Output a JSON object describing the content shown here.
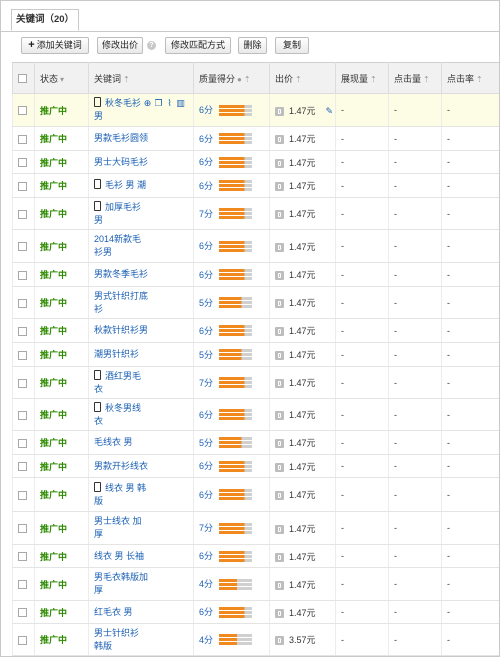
{
  "tab": {
    "label": "关键词（20）"
  },
  "toolbar": {
    "add": "添加关键词",
    "modify_price": "修改出价",
    "modify_match": "修改匹配方式",
    "delete": "删除",
    "copy": "复制"
  },
  "columns": {
    "status": "状态",
    "keyword": "关键词",
    "quality": "质量得分",
    "price": "出价",
    "impressions": "展现量",
    "clicks": "点击量",
    "ctr": "点击率"
  },
  "rows": [
    {
      "status": "推广中",
      "l1": "秋冬毛衫",
      "l2": "男",
      "mobile": true,
      "score": "6分",
      "price": "1.47元",
      "imp": "-",
      "clk": "-",
      "ctr": "-"
    },
    {
      "status": "推广中",
      "l1": "男款毛衫圆领",
      "l2": "",
      "mobile": false,
      "score": "6分",
      "price": "1.47元",
      "imp": "-",
      "clk": "-",
      "ctr": "-"
    },
    {
      "status": "推广中",
      "l1": "男士大码毛衫",
      "l2": "",
      "mobile": false,
      "score": "6分",
      "price": "1.47元",
      "imp": "-",
      "clk": "-",
      "ctr": "-"
    },
    {
      "status": "推广中",
      "l1": "毛衫 男 潮",
      "l2": "",
      "mobile": true,
      "score": "6分",
      "price": "1.47元",
      "imp": "-",
      "clk": "-",
      "ctr": "-"
    },
    {
      "status": "推广中",
      "l1": "加厚毛衫",
      "l2": "男",
      "mobile": true,
      "score": "7分",
      "price": "1.47元",
      "imp": "-",
      "clk": "-",
      "ctr": "-"
    },
    {
      "status": "推广中",
      "l1": "2014新款毛",
      "l2": "衫男",
      "mobile": false,
      "score": "6分",
      "price": "1.47元",
      "imp": "-",
      "clk": "-",
      "ctr": "-"
    },
    {
      "status": "推广中",
      "l1": "男款冬季毛衫",
      "l2": "",
      "mobile": false,
      "score": "6分",
      "price": "1.47元",
      "imp": "-",
      "clk": "-",
      "ctr": "-"
    },
    {
      "status": "推广中",
      "l1": "男式针织打底",
      "l2": "衫",
      "mobile": false,
      "score": "5分",
      "price": "1.47元",
      "imp": "-",
      "clk": "-",
      "ctr": "-"
    },
    {
      "status": "推广中",
      "l1": "秋款针织衫男",
      "l2": "",
      "mobile": false,
      "score": "6分",
      "price": "1.47元",
      "imp": "-",
      "clk": "-",
      "ctr": "-"
    },
    {
      "status": "推广中",
      "l1": "潮男针织衫",
      "l2": "",
      "mobile": false,
      "score": "5分",
      "price": "1.47元",
      "imp": "-",
      "clk": "-",
      "ctr": "-"
    },
    {
      "status": "推广中",
      "l1": "酒红男毛",
      "l2": "衣",
      "mobile": true,
      "score": "7分",
      "price": "1.47元",
      "imp": "-",
      "clk": "-",
      "ctr": "-"
    },
    {
      "status": "推广中",
      "l1": "秋冬男线",
      "l2": "衣",
      "mobile": true,
      "score": "6分",
      "price": "1.47元",
      "imp": "-",
      "clk": "-",
      "ctr": "-"
    },
    {
      "status": "推广中",
      "l1": "毛线衣 男",
      "l2": "",
      "mobile": false,
      "score": "5分",
      "price": "1.47元",
      "imp": "-",
      "clk": "-",
      "ctr": "-"
    },
    {
      "status": "推广中",
      "l1": "男款开衫线衣",
      "l2": "",
      "mobile": false,
      "score": "6分",
      "price": "1.47元",
      "imp": "-",
      "clk": "-",
      "ctr": "-"
    },
    {
      "status": "推广中",
      "l1": "线衣 男 韩",
      "l2": "版",
      "mobile": true,
      "score": "6分",
      "price": "1.47元",
      "imp": "-",
      "clk": "-",
      "ctr": "-"
    },
    {
      "status": "推广中",
      "l1": "男士线衣 加",
      "l2": "厚",
      "mobile": false,
      "score": "7分",
      "price": "1.47元",
      "imp": "-",
      "clk": "-",
      "ctr": "-"
    },
    {
      "status": "推广中",
      "l1": "线衣 男 长袖",
      "l2": "",
      "mobile": false,
      "score": "6分",
      "price": "1.47元",
      "imp": "-",
      "clk": "-",
      "ctr": "-"
    },
    {
      "status": "推广中",
      "l1": "男毛衣韩版加",
      "l2": "厚",
      "mobile": false,
      "score": "4分",
      "price": "1.47元",
      "imp": "-",
      "clk": "-",
      "ctr": "-"
    },
    {
      "status": "推广中",
      "l1": "红毛衣 男",
      "l2": "",
      "mobile": false,
      "score": "6分",
      "price": "1.47元",
      "imp": "-",
      "clk": "-",
      "ctr": "-"
    },
    {
      "status": "推广中",
      "l1": "男士针织衫",
      "l2": "韩版",
      "mobile": false,
      "score": "4分",
      "price": "3.57元",
      "imp": "-",
      "clk": "-",
      "ctr": "-"
    }
  ]
}
